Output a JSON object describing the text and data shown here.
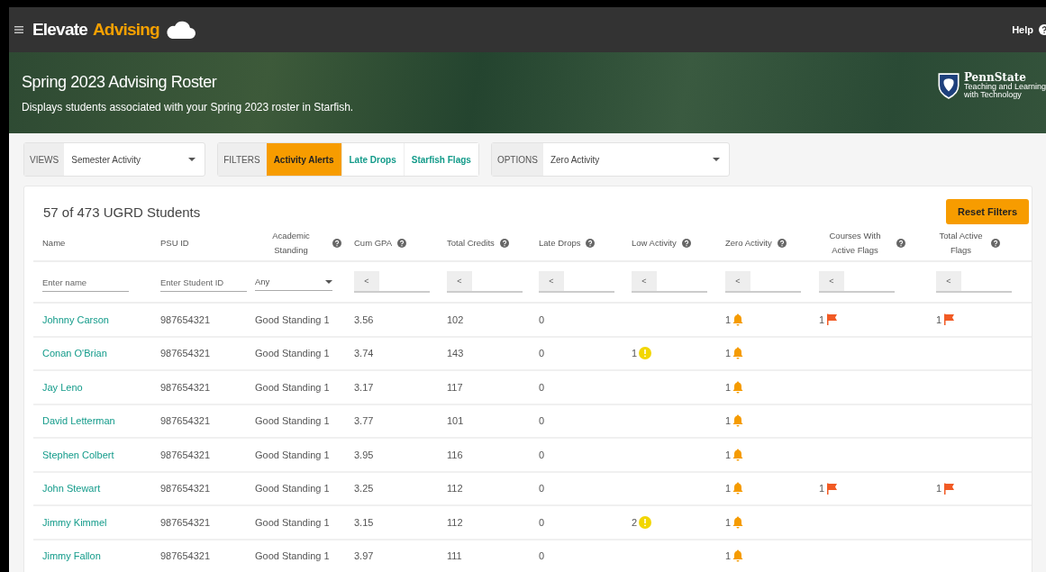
{
  "app": {
    "title_part1": "Elevate",
    "title_part2": "Advising",
    "help": "Help"
  },
  "banner": {
    "title": "Spring 2023 Advising Roster",
    "subtitle": "Displays students associated with your Spring 2023 roster in Starfish.",
    "logo_name": "PennState",
    "logo_line1": "Teaching and Learning",
    "logo_line2": "with Technology"
  },
  "views": {
    "label": "VIEWS",
    "value": "Semester Activity"
  },
  "filters": {
    "label": "FILTERS",
    "items": [
      {
        "label": "Activity Alerts",
        "selected": true
      },
      {
        "label": "Late Drops",
        "selected": false
      },
      {
        "label": "Starfish Flags",
        "selected": false
      }
    ]
  },
  "options": {
    "label": "OPTIONS",
    "value": "Zero Activity"
  },
  "table": {
    "count": "57 of 473 UGRD Students",
    "reset": "Reset Filters",
    "columns": [
      {
        "label": "Name",
        "help": false
      },
      {
        "label": "PSU ID",
        "help": false
      },
      {
        "label": "Academic Standing",
        "help": true
      },
      {
        "label": "Cum GPA",
        "help": true
      },
      {
        "label": "Total Credits",
        "help": true
      },
      {
        "label": "Late Drops",
        "help": true
      },
      {
        "label": "Low Activity",
        "help": true
      },
      {
        "label": "Zero Activity",
        "help": true
      },
      {
        "label": "Courses With Active Flags",
        "help": true
      },
      {
        "label": "Total Active Flags",
        "help": true
      }
    ],
    "filter_row": [
      {
        "kind": "text",
        "placeholder": "Enter name"
      },
      {
        "kind": "text",
        "placeholder": "Enter Student ID"
      },
      {
        "kind": "select",
        "value": "Any"
      },
      {
        "kind": "op",
        "value": "<"
      },
      {
        "kind": "op",
        "value": "<"
      },
      {
        "kind": "op",
        "value": "<"
      },
      {
        "kind": "op",
        "value": "<"
      },
      {
        "kind": "op",
        "value": "<"
      },
      {
        "kind": "op",
        "value": "<"
      },
      {
        "kind": "op",
        "value": "<"
      }
    ],
    "rows": [
      {
        "name": "Johnny Carson",
        "psu_id": "987654321",
        "standing": "Good Standing 1",
        "gpa": "3.56",
        "credits": "102",
        "late_drops": "0",
        "zero_activity": "1",
        "course_flags": "1",
        "total_flags": "1"
      },
      {
        "name": "Conan O'Brian",
        "psu_id": "987654321",
        "standing": "Good Standing 1",
        "gpa": "3.74",
        "credits": "143",
        "late_drops": "0",
        "low_activity": "1",
        "zero_activity": "1"
      },
      {
        "name": "Jay Leno",
        "psu_id": "987654321",
        "standing": "Good Standing 1",
        "gpa": "3.17",
        "credits": "117",
        "late_drops": "0",
        "zero_activity": "1"
      },
      {
        "name": "David Letterman",
        "psu_id": "987654321",
        "standing": "Good Standing 1",
        "gpa": "3.77",
        "credits": "101",
        "late_drops": "0",
        "zero_activity": "1"
      },
      {
        "name": "Stephen Colbert",
        "psu_id": "987654321",
        "standing": "Good Standing 1",
        "gpa": "3.95",
        "credits": "116",
        "late_drops": "0",
        "zero_activity": "1"
      },
      {
        "name": "John Stewart",
        "psu_id": "987654321",
        "standing": "Good Standing 1",
        "gpa": "3.25",
        "credits": "112",
        "late_drops": "0",
        "zero_activity": "1",
        "course_flags": "1",
        "total_flags": "1"
      },
      {
        "name": "Jimmy Kimmel",
        "psu_id": "987654321",
        "standing": "Good Standing 1",
        "gpa": "3.15",
        "credits": "112",
        "late_drops": "0",
        "low_activity": "2",
        "zero_activity": "1"
      },
      {
        "name": "Jimmy Fallon",
        "psu_id": "987654321",
        "standing": "Good Standing 1",
        "gpa": "3.97",
        "credits": "111",
        "late_drops": "0",
        "zero_activity": "1"
      }
    ]
  }
}
